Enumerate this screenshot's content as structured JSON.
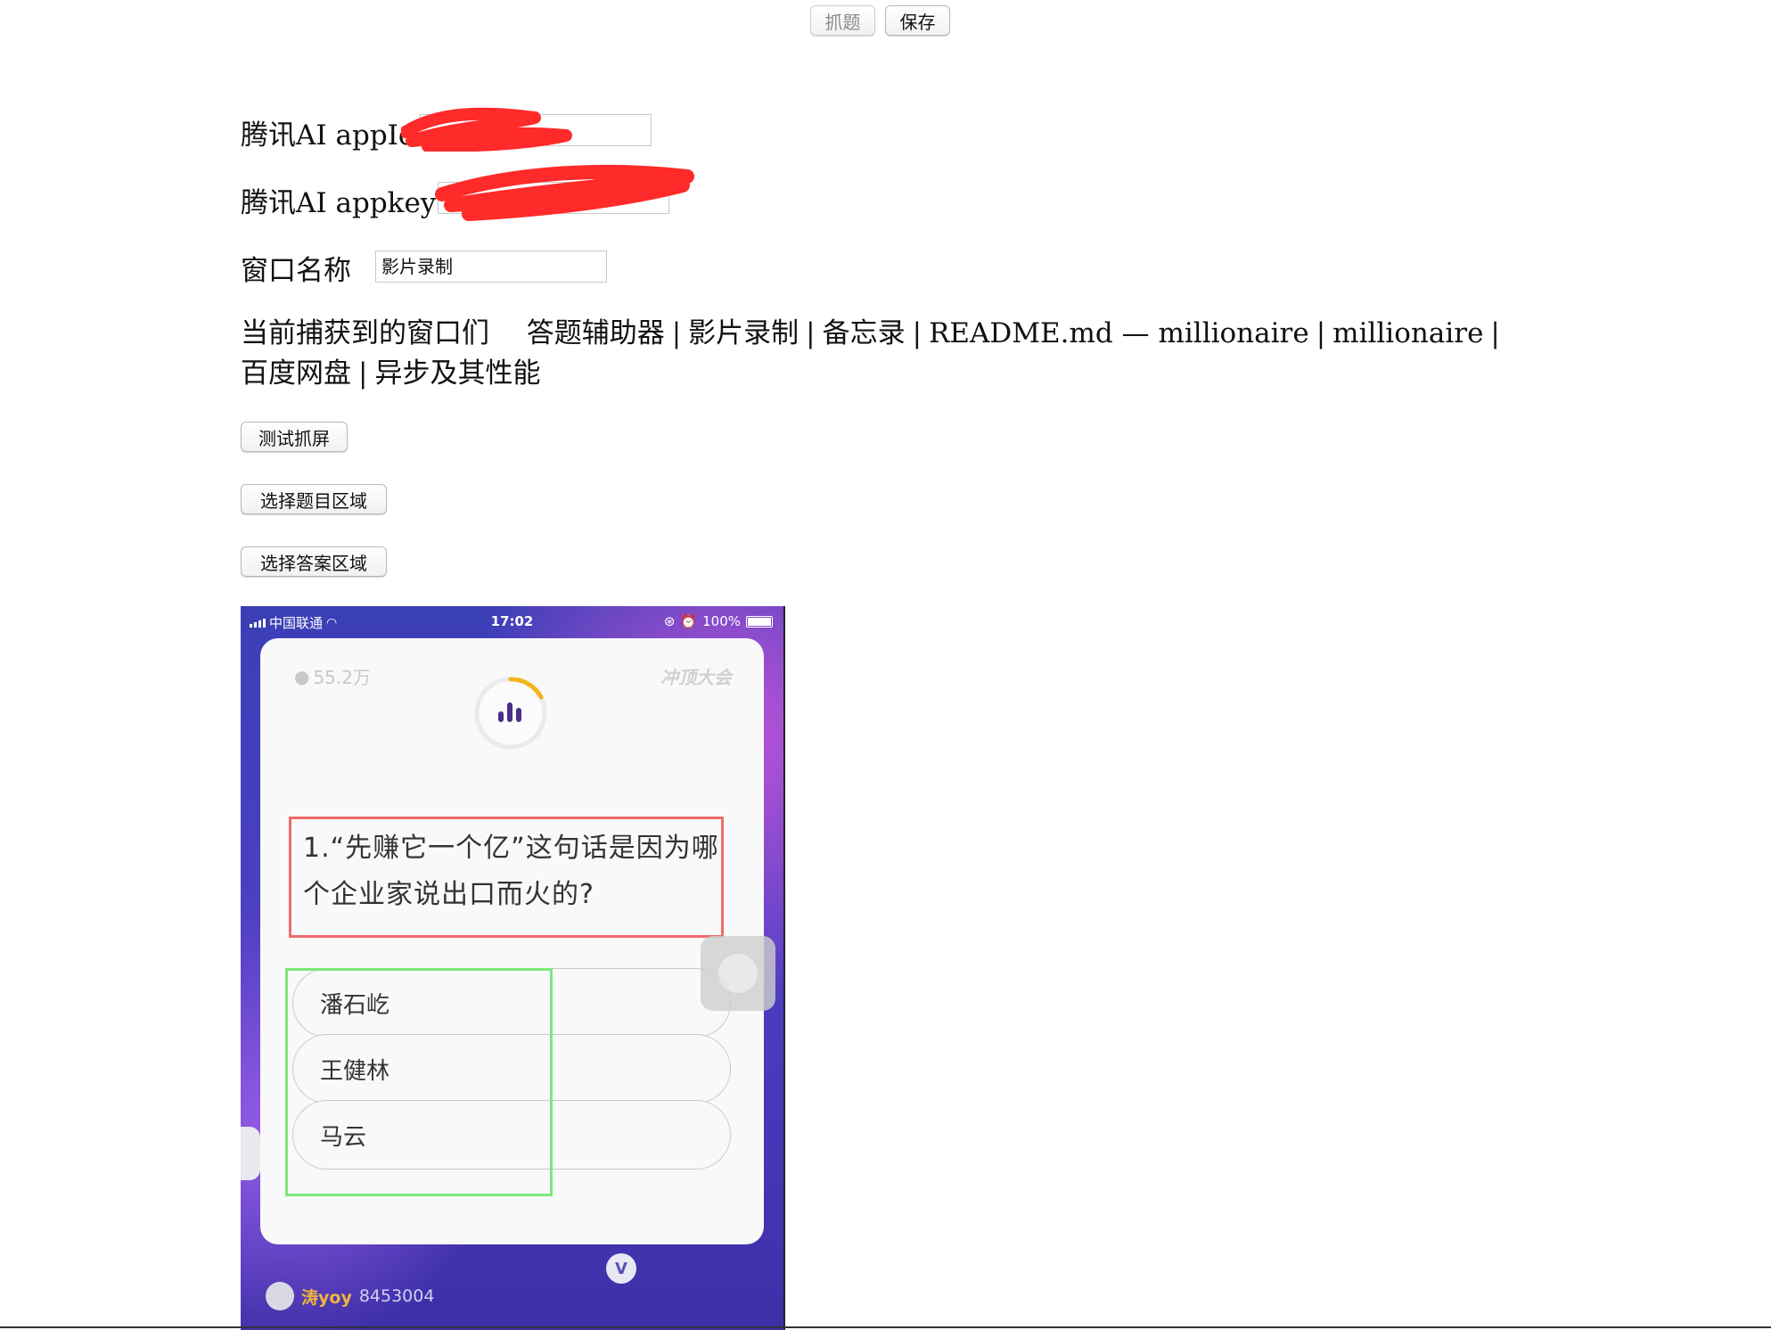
{
  "toolbar": {
    "capture_label": "抓题",
    "save_label": "保存"
  },
  "form": {
    "appid_label": "腾讯AI appId",
    "appid_value": "",
    "appkey_label": "腾讯AI appkey",
    "appkey_value": "",
    "window_name_label": "窗口名称",
    "window_name_value": "影片录制"
  },
  "captured_windows": {
    "label": "当前捕获到的窗口们",
    "items": [
      "答题辅助器",
      "影片录制",
      "备忘录",
      "README.md — millionaire",
      "millionaire",
      "百度网盘",
      "异步及其性能"
    ]
  },
  "actions": {
    "test_capture_label": "测试抓屏",
    "select_question_label": "选择题目区域",
    "select_answer_label": "选择答案区域"
  },
  "phone": {
    "carrier": "中国联通",
    "time": "17:02",
    "battery": "100%",
    "viewers": "55.2万",
    "brand": "冲顶大会",
    "question": "1.“先赚它一个亿”这句话是因为哪个企业家说出口而火的?",
    "options": [
      "潘石屹",
      "王健林",
      "马云"
    ],
    "v_badge": "V",
    "username": "涛yoy",
    "user_score": "8453004"
  },
  "colors": {
    "question_box": "#ef6b6b",
    "answer_box": "#7ee77c",
    "redaction": "#ff2a2a"
  }
}
